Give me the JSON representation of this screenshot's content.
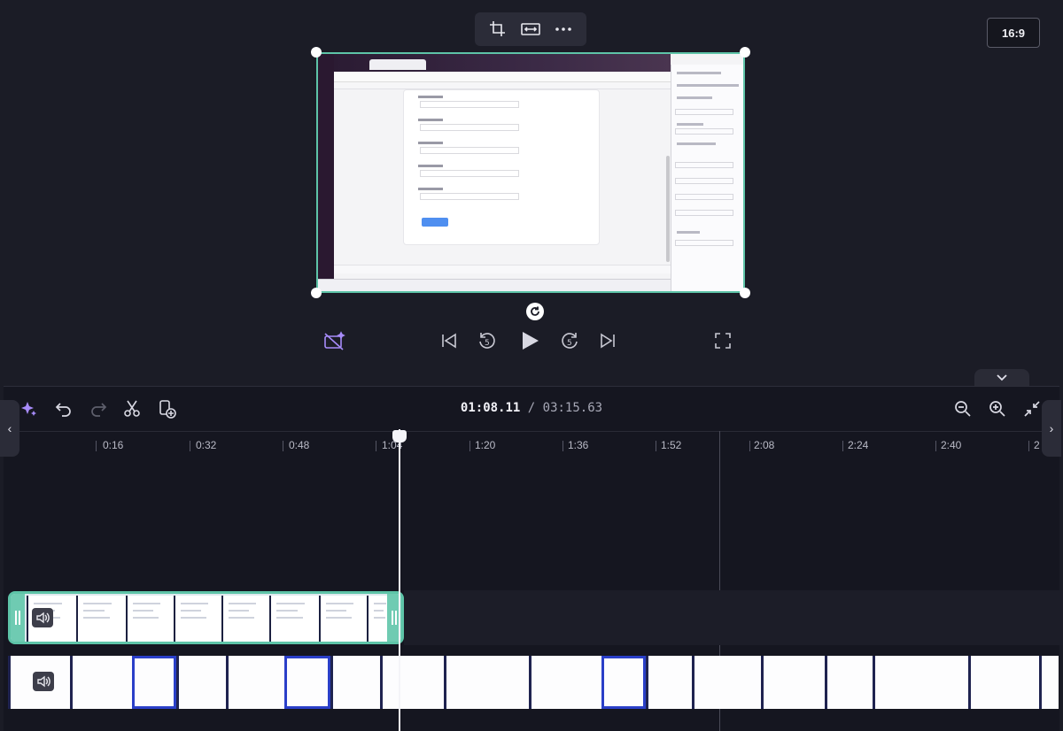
{
  "preview": {
    "aspect_ratio": "16:9",
    "toolbar": [
      "crop-icon",
      "fit-icon",
      "more-icon"
    ]
  },
  "transport": {
    "controls": [
      "magic-camera-icon",
      "skip-back-icon",
      "rewind-5-icon",
      "play-icon",
      "forward-5-icon",
      "skip-forward-icon",
      "fullscreen-icon"
    ],
    "rewind_label": "5",
    "forward_label": "5"
  },
  "timeline": {
    "current_time": "01:08.11",
    "separator": " / ",
    "total_time": "03:15.63",
    "ticks": [
      "0:16",
      "0:32",
      "0:48",
      "1:04",
      "1:20",
      "1:36",
      "1:52",
      "2:08",
      "2:24",
      "2:40",
      "2"
    ]
  },
  "colors": {
    "accent": "#5ec4a8",
    "background": "#1b1c26",
    "timeline_bg": "#151620",
    "magic_purple": "#a78bfa"
  }
}
